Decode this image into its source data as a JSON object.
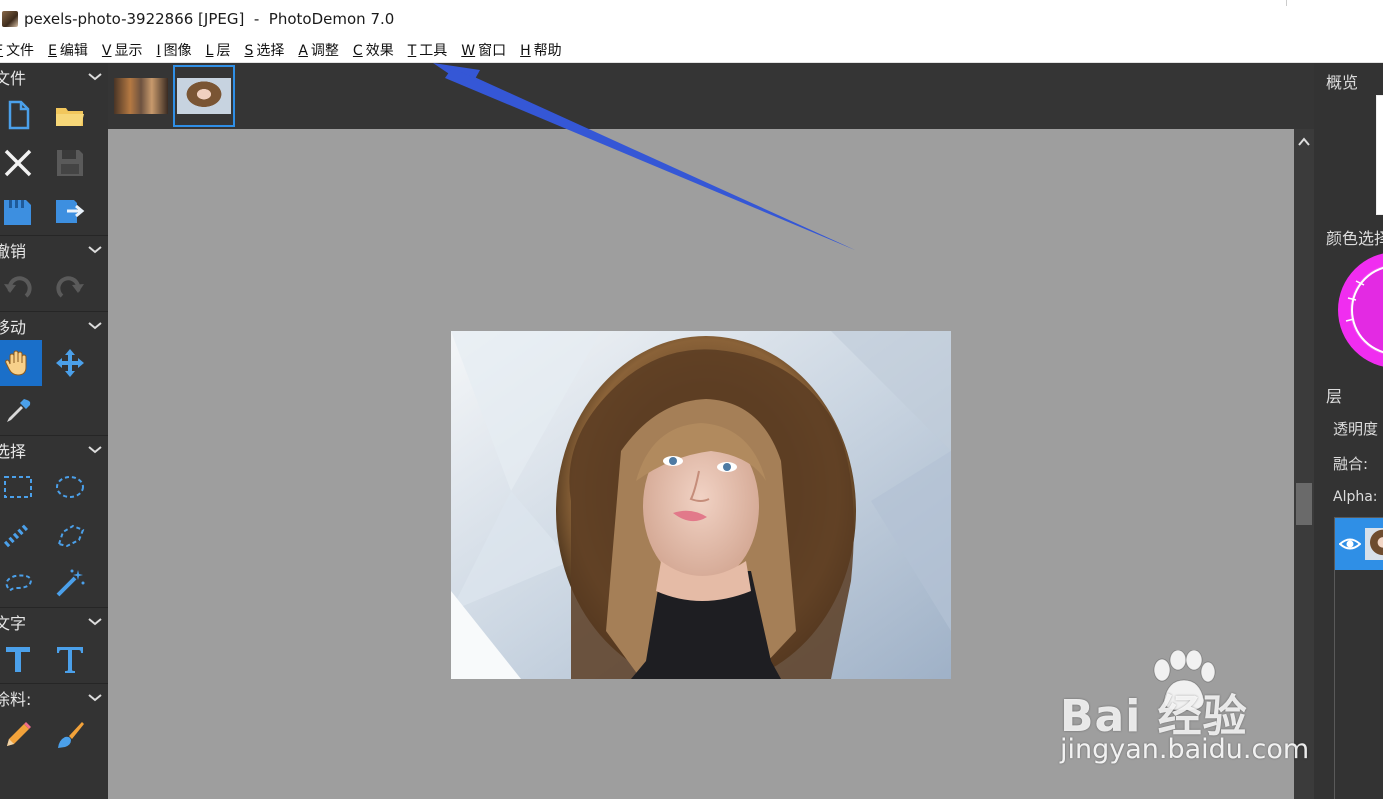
{
  "window": {
    "title": "pexels-photo-3922866 [JPEG]  -  PhotoDemon 7.0"
  },
  "menu": [
    {
      "key": "F",
      "label": "文件"
    },
    {
      "key": "E",
      "label": "编辑"
    },
    {
      "key": "V",
      "label": "显示"
    },
    {
      "key": "I",
      "label": "图像"
    },
    {
      "key": "L",
      "label": "层"
    },
    {
      "key": "S",
      "label": "选择"
    },
    {
      "key": "A",
      "label": "调整"
    },
    {
      "key": "C",
      "label": "效果"
    },
    {
      "key": "T",
      "label": "工具"
    },
    {
      "key": "W",
      "label": "窗口"
    },
    {
      "key": "H",
      "label": "帮助"
    }
  ],
  "toolbox": {
    "sections": {
      "file": "文件",
      "undo": "撤销",
      "move": "移动",
      "select": "选择",
      "text": "文字",
      "paint": "涂料:"
    },
    "icons": {
      "new": "new-file-icon",
      "open": "open-folder-icon",
      "close": "close-icon",
      "save": "save-icon",
      "save_as": "save-copy-icon",
      "export": "export-icon",
      "undo": "undo-icon",
      "redo": "redo-icon",
      "hand": "hand-icon",
      "move": "move-arrows-icon",
      "eyedropper": "eyedropper-icon",
      "rect_select": "rect-select-icon",
      "ellipse_select": "ellipse-select-icon",
      "line_select": "line-select-icon",
      "polygon_select": "polygon-select-icon",
      "lasso_select": "lasso-select-icon",
      "magic_wand": "magic-wand-icon",
      "text_basic": "text-basic-icon",
      "text_typography": "text-typography-icon",
      "pencil": "pencil-icon",
      "brush": "brush-icon"
    },
    "active_tool": "hand"
  },
  "right_panel": {
    "overview_title": "概览",
    "color_title": "颜色选择",
    "layers_title": "层",
    "opacity_label": "透明度",
    "blend_label": "融合:",
    "alpha_label": "Alpha:"
  },
  "colors": {
    "accent": "#2f8fe6",
    "toolbar_bg": "#333333",
    "canvas_bg": "#9e9e9e",
    "arrow": "#3557d6",
    "color_wheel": "#f02df0"
  },
  "watermark": {
    "main": "Bai  经验",
    "sub": "jingyan.baidu.com"
  }
}
